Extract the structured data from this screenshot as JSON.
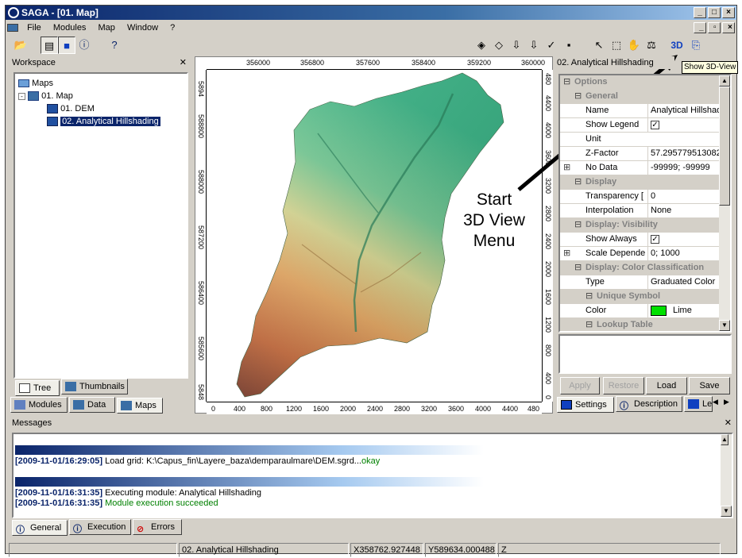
{
  "window": {
    "title": "SAGA - [01. Map]"
  },
  "menu": [
    "File",
    "Modules",
    "Map",
    "Window",
    "?"
  ],
  "workspace": {
    "title": "Workspace",
    "tree": [
      "Maps",
      "01. Map",
      "01. DEM",
      "02. Analytical Hillshading"
    ],
    "tabs": [
      "Tree",
      "Thumbnails"
    ],
    "bottom_tabs": [
      "Modules",
      "Data",
      "Maps"
    ]
  },
  "map": {
    "x_ticks_top": [
      "356000",
      "356800",
      "357600",
      "358400",
      "359200",
      "360000"
    ],
    "x_ticks_bottom": [
      "0",
      "400",
      "800",
      "1200",
      "1600",
      "2000",
      "2400",
      "2800",
      "3200",
      "3600",
      "4000",
      "4400",
      "480"
    ],
    "y_ticks_left": [
      "5894",
      "588800",
      "588000",
      "587200",
      "586400",
      "585600",
      "5848"
    ],
    "y_ticks_right": [
      "480",
      "4400",
      "4000",
      "3600",
      "3200",
      "2800",
      "2400",
      "2000",
      "1600",
      "1200",
      "800",
      "400",
      "0"
    ]
  },
  "annotation": {
    "line1": "Start",
    "line2": "3D View",
    "line3": "Menu"
  },
  "tooltip": "Show 3D-View",
  "properties": {
    "title": "02. Analytical Hillshading",
    "rows": [
      {
        "type": "cat",
        "name": "Options",
        "exp": "⊟"
      },
      {
        "type": "cat",
        "name": "General",
        "exp": "⊟",
        "indent": 1
      },
      {
        "name": "Name",
        "value": "Analytical Hillshadi"
      },
      {
        "name": "Show Legend",
        "value": "",
        "check": true
      },
      {
        "name": "Unit",
        "value": ""
      },
      {
        "name": "Z-Factor",
        "value": "57.295779513082"
      },
      {
        "name": "No Data",
        "value": "-99999; -99999",
        "exp": "⊞"
      },
      {
        "type": "cat",
        "name": "Display",
        "exp": "⊟",
        "indent": 1
      },
      {
        "name": "Transparency [",
        "value": "0"
      },
      {
        "name": "Interpolation",
        "value": "None"
      },
      {
        "type": "cat",
        "name": "Display: Visibility",
        "exp": "⊟",
        "indent": 1
      },
      {
        "name": "Show Always",
        "value": "",
        "check": true
      },
      {
        "name": "Scale Depende",
        "value": "0; 1000",
        "exp": "⊞"
      },
      {
        "type": "cat",
        "name": "Display: Color Classification",
        "exp": "⊟",
        "indent": 1
      },
      {
        "name": "Type",
        "value": "Graduated Color"
      },
      {
        "type": "cat",
        "name": "Unique Symbol",
        "exp": "⊟",
        "indent": 2
      },
      {
        "name": "Color",
        "value": "Lime",
        "swatch": "#00e000",
        "indent": 1
      },
      {
        "type": "cat",
        "name": "Lookup Table",
        "exp": "⊟",
        "indent": 2
      }
    ],
    "buttons": [
      "Apply",
      "Restore",
      "Load",
      "Save"
    ],
    "tabs": [
      "Settings",
      "Description",
      "Le"
    ]
  },
  "messages": {
    "title": "Messages",
    "lines": [
      {
        "ts": "[2009-11-01/16:29:05]",
        "text": " Load grid: K:\\Capus_fin\\Layere_baza\\demparaulmare\\DEM.sgrd...",
        "ok": "okay"
      },
      {
        "ts": "[2009-11-01/16:31:35]",
        "text": " Executing module: Analytical Hillshading",
        "ok": ""
      },
      {
        "ts": "[2009-11-01/16:31:35]",
        "text": "",
        "ok": " Module execution succeeded"
      }
    ],
    "tabs": [
      "General",
      "Execution",
      "Errors"
    ]
  },
  "status": {
    "layer": "02. Analytical Hillshading",
    "x": "X358762.927448",
    "y": "Y589634.000488",
    "z": "Z"
  },
  "colors": {
    "accent": "#0a246a",
    "ok": "#008000",
    "swatch": "#00e000"
  }
}
